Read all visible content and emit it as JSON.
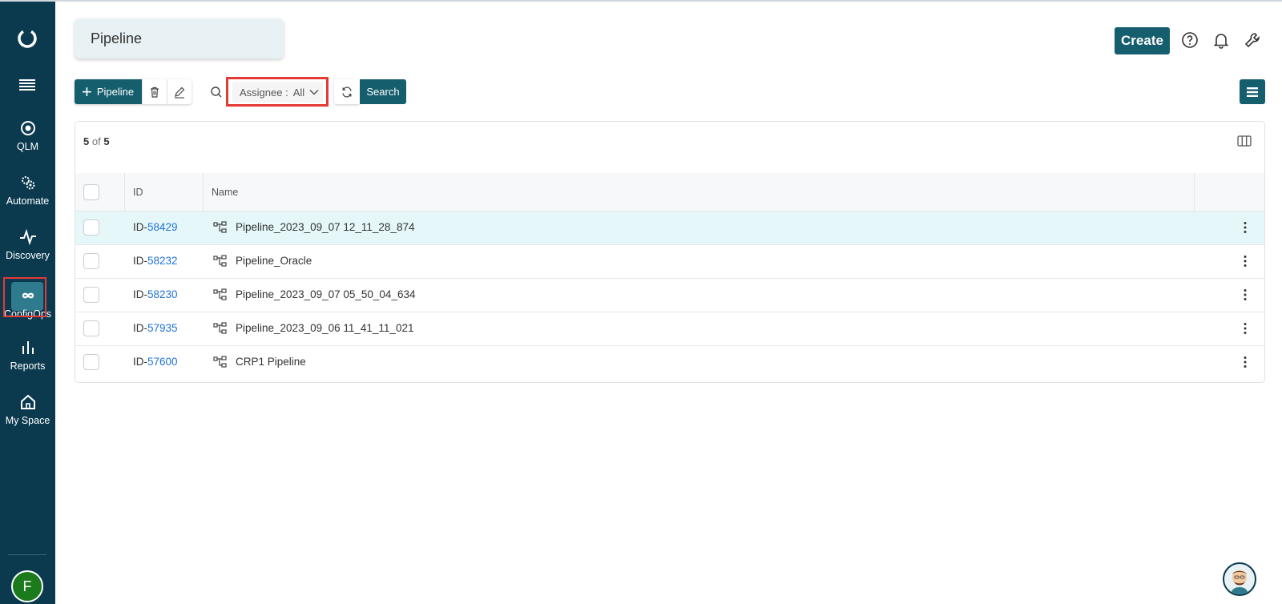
{
  "sidebar": {
    "items": [
      {
        "label": "QLM",
        "icon": "qlm-icon"
      },
      {
        "label": "Automate",
        "icon": "automate-gears-icon"
      },
      {
        "label": "Discovery",
        "icon": "pulse-icon"
      },
      {
        "label": "ConfigOps",
        "icon": "infinity-link-icon"
      },
      {
        "label": "Reports",
        "icon": "bar-chart-icon"
      },
      {
        "label": "My Space",
        "icon": "home-icon"
      }
    ],
    "user_initial": "F"
  },
  "header": {
    "title": "Pipeline",
    "create_label": "Create"
  },
  "toolbar": {
    "add_label": "Pipeline",
    "assignee_label": "Assignee :",
    "assignee_value": "All",
    "search_label": "Search"
  },
  "table": {
    "count_shown": "5",
    "count_of": "of",
    "count_total": "5",
    "columns": [
      "ID",
      "Name"
    ],
    "rows": [
      {
        "id_prefix": "ID-",
        "id_num": "58429",
        "name": "Pipeline_2023_09_07 12_11_28_874"
      },
      {
        "id_prefix": "ID-",
        "id_num": "58232",
        "name": "Pipeline_Oracle"
      },
      {
        "id_prefix": "ID-",
        "id_num": "58230",
        "name": "Pipeline_2023_09_07 05_50_04_634"
      },
      {
        "id_prefix": "ID-",
        "id_num": "57935",
        "name": "Pipeline_2023_09_06 11_41_11_021"
      },
      {
        "id_prefix": "ID-",
        "id_num": "57600",
        "name": "CRP1 Pipeline"
      }
    ]
  },
  "colors": {
    "sidebar_bg": "#0b3a4f",
    "primary": "#155e6e",
    "link": "#1e73d6",
    "highlight_box": "#e53935",
    "selected_row": "#e6f7fa"
  }
}
